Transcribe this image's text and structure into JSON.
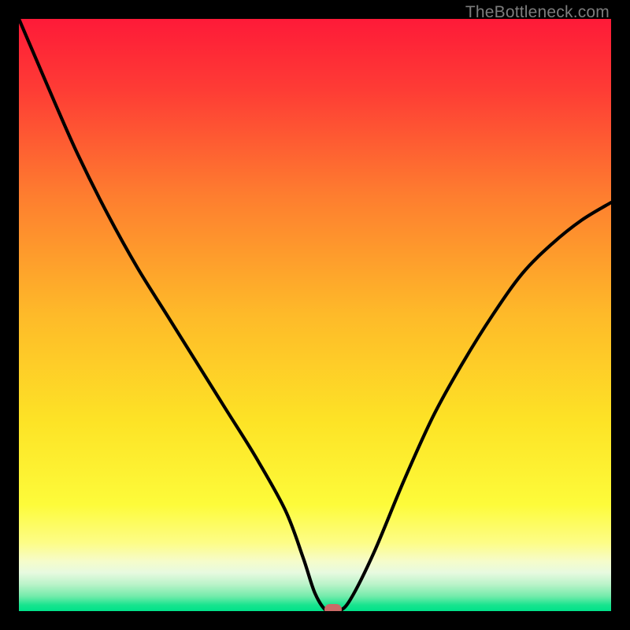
{
  "watermark": "TheBottleneck.com",
  "colors": {
    "frame": "#000000",
    "gradient_top": "#fe1a38",
    "gradient_mid_upper": "#fe8d2d",
    "gradient_mid": "#fdde27",
    "gradient_lower": "#fdfc6e",
    "gradient_pale": "#f4fbc6",
    "gradient_green_pale": "#c6f6c2",
    "gradient_green": "#00e48a",
    "curve": "#000000",
    "marker": "#cb6a67",
    "watermark": "#7d7d7d"
  },
  "chart_data": {
    "type": "line",
    "title": "",
    "xlabel": "",
    "ylabel": "",
    "xlim": [
      0,
      100
    ],
    "ylim": [
      0,
      100
    ],
    "x": [
      0,
      3,
      6,
      10,
      15,
      20,
      25,
      30,
      35,
      40,
      45,
      48,
      50,
      52,
      54,
      56,
      60,
      65,
      70,
      75,
      80,
      85,
      90,
      95,
      100
    ],
    "values": [
      100,
      93,
      86,
      77,
      67,
      58,
      50,
      42,
      34,
      26,
      17,
      9,
      3,
      0,
      0,
      2,
      10,
      22,
      33,
      42,
      50,
      57,
      62,
      66,
      69
    ],
    "marker": {
      "x": 53,
      "y": 0
    },
    "note": "V-shaped bottleneck curve over vertical red→yellow→green gradient; minimum at x≈53. Values are relative percentages read off the plot (no visible axes/ticks)."
  }
}
